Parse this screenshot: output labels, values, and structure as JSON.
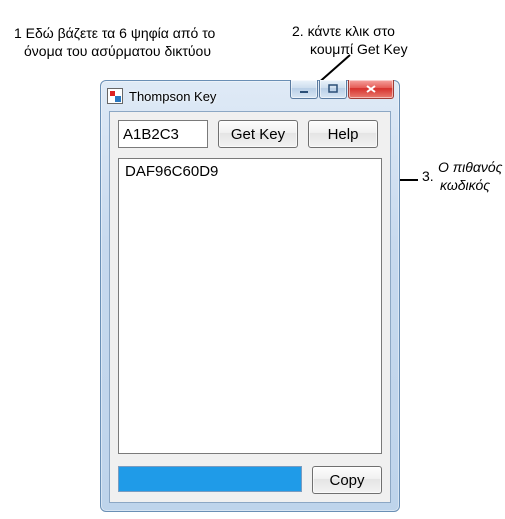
{
  "annotations": {
    "a1_line1": "1 Εδώ βάζετε τα 6 ψηφία από το",
    "a1_line2": "όνομα του ασύρματου δικτύου",
    "a2_line1": "2. κάντε κλικ στο",
    "a2_line2": "κουμπί Get Key",
    "a3_line1": "Ο πιθανός",
    "a3_line2": "κωδικός",
    "a3_num": "3."
  },
  "window": {
    "title": "Thompson Key"
  },
  "inputs": {
    "digits_value": "A1B2C3"
  },
  "buttons": {
    "getkey": "Get Key",
    "help": "Help",
    "copy": "Copy"
  },
  "result": "DAF96C60D9"
}
